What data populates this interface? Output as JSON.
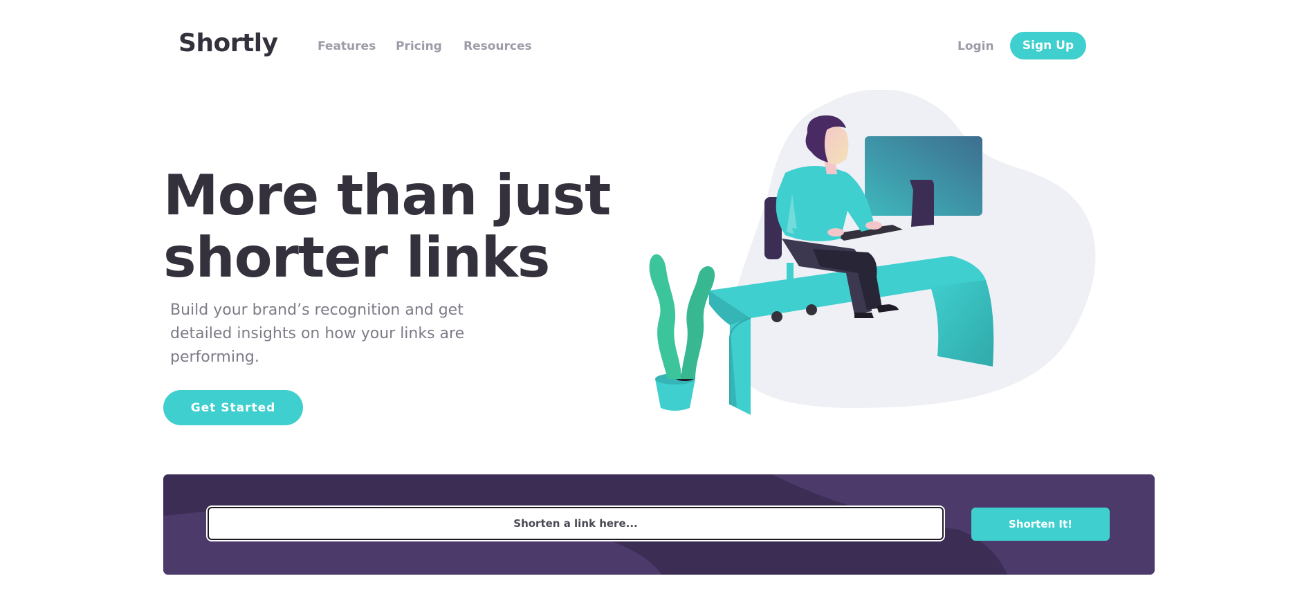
{
  "header": {
    "logo": "Shortly",
    "nav": {
      "features": "Features",
      "pricing": "Pricing",
      "resources": "Resources"
    },
    "login": "Login",
    "signup": "Sign Up"
  },
  "hero": {
    "title_line1": "More than just",
    "title_line2": "shorter links",
    "subtitle": "Build your brand’s recognition and get detailed insights on how your links are performing.",
    "cta": "Get Started"
  },
  "shorten": {
    "placeholder": "Shorten a link here...",
    "button": "Shorten It!"
  },
  "colors": {
    "accent": "#3fcfce",
    "dark_violet": "#3b2d54",
    "heading": "#34313d",
    "muted": "#9e9aa7"
  }
}
